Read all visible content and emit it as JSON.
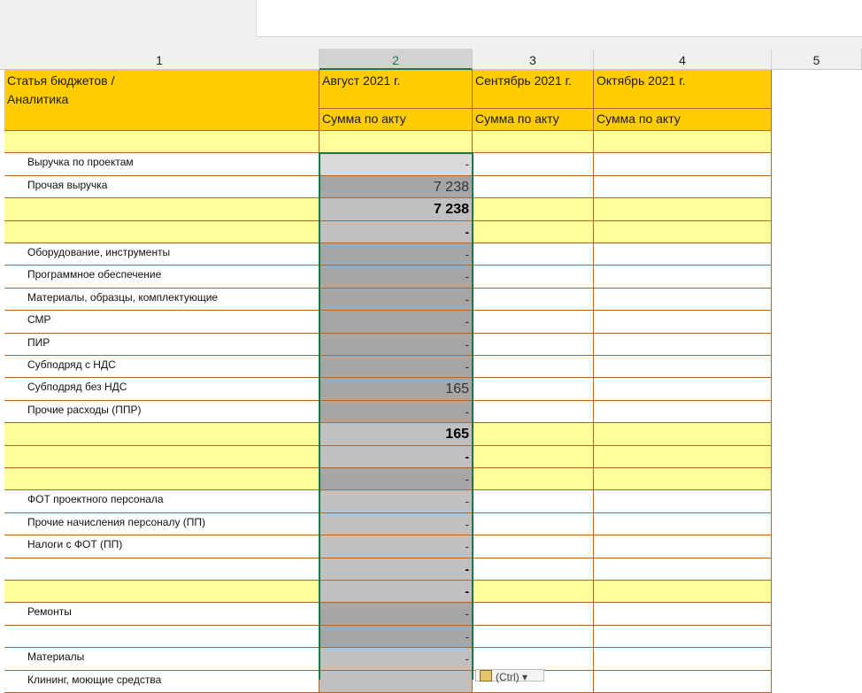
{
  "columns": [
    "1",
    "2",
    "3",
    "4",
    "5"
  ],
  "header": {
    "col1_line1": "Статья бюджетов /",
    "col1_line2": "Аналитика",
    "months": [
      "Август 2021 г.",
      "Сентябрь 2021 г.",
      "Октябрь 2021 г."
    ],
    "sub": "Сумма по акту"
  },
  "rows": [
    {
      "label": "",
      "value": ""
    },
    {
      "label": "Выручка по проектам",
      "value": "-"
    },
    {
      "label": "Прочая выручка",
      "value": "7 238"
    },
    {
      "label": "",
      "value": "7 238"
    },
    {
      "label": "",
      "value": "-"
    },
    {
      "label": "Оборудование, инструменты",
      "value": "-"
    },
    {
      "label": "Программное обеспечение",
      "value": "-"
    },
    {
      "label": "Материалы, образцы, комплектующие",
      "value": "-"
    },
    {
      "label": "СМР",
      "value": "-"
    },
    {
      "label": "ПИР",
      "value": "-"
    },
    {
      "label": "Субподряд с НДС",
      "value": "-"
    },
    {
      "label": "Субподряд без НДС",
      "value": "165"
    },
    {
      "label": "Прочие расходы (ППР)",
      "value": "-"
    },
    {
      "label": "",
      "value": "165"
    },
    {
      "label": "",
      "value": "-"
    },
    {
      "label": "",
      "value": "-"
    },
    {
      "label": "ФОТ проектного персонала",
      "value": "-"
    },
    {
      "label": "Прочие начисления персоналу (ПП)",
      "value": "-"
    },
    {
      "label": "Налоги с ФОТ (ПП)",
      "value": "-"
    },
    {
      "label": "",
      "value": "-"
    },
    {
      "label": "",
      "value": "-"
    },
    {
      "label": "Ремонты",
      "value": "-"
    },
    {
      "label": "",
      "value": "-"
    },
    {
      "label": "Материалы",
      "value": "-"
    },
    {
      "label": "Клининг, моющие средства",
      "value": ""
    }
  ],
  "paste_options": "(Ctrl) ▾"
}
